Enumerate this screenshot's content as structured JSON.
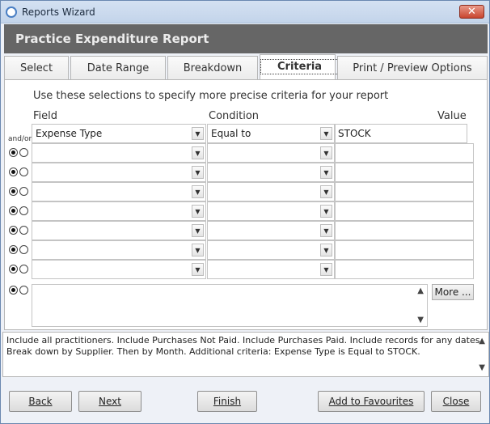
{
  "window": {
    "title": "Reports Wizard",
    "close_glyph": "✕"
  },
  "header": {
    "title": "Practice Expenditure Report"
  },
  "tabs": [
    {
      "label": "Select"
    },
    {
      "label": "Date Range"
    },
    {
      "label": "Breakdown"
    },
    {
      "label": "Criteria",
      "active": true
    },
    {
      "label": "Print / Preview Options"
    }
  ],
  "criteria": {
    "intro": "Use these selections to specify more precise criteria for your report",
    "headers": {
      "field": "Field",
      "condition": "Condition",
      "value": "Value"
    },
    "andor_label": "and/or",
    "first_row": {
      "field": "Expense Type",
      "condition": "Equal to",
      "value": "STOCK"
    },
    "more_label": "More ..."
  },
  "summary": {
    "line1": "Include all practitioners. Include Purchases Not Paid. Include Purchases Paid. Include records for any dates.",
    "line2": "Break down by Supplier. Then by Month. Additional criteria: Expense Type is Equal to STOCK."
  },
  "footer": {
    "back": "Back",
    "next": "Next",
    "finish": "Finish",
    "add_favourites": "Add to Favourites",
    "close": "Close"
  },
  "colors": {
    "header_bg": "#666666",
    "close_btn": "#c8452f"
  }
}
